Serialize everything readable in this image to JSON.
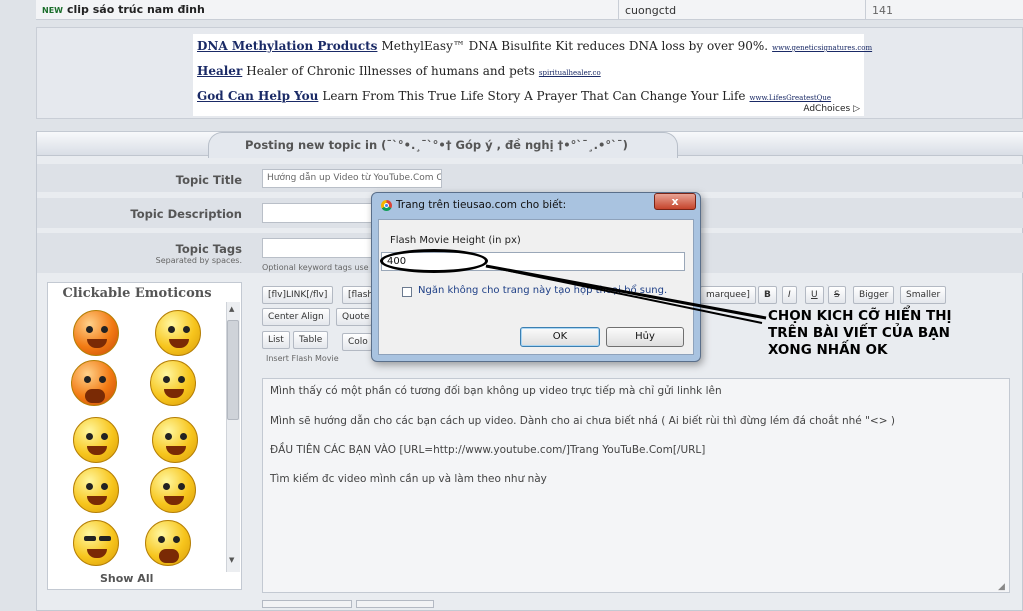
{
  "topic_row": {
    "badge": "NEW",
    "title": "clip sáo trúc nam đinh",
    "author": "cuongctd",
    "count": "141"
  },
  "ads": {
    "items": [
      {
        "headline": "DNA Methylation Products",
        "text": "MethylEasy™ DNA Bisulfite Kit reduces DNA loss by over 90%.",
        "url": "www.geneticsignatures.com"
      },
      {
        "headline": "Healer",
        "text": "Healer of Chronic Illnesses of humans and pets",
        "url": "spiritualhealer.co"
      },
      {
        "headline": "God Can Help You",
        "text": "Learn From This True Life Story A Prayer That Can Change Your Life",
        "url": "www.LifesGreatestQue"
      }
    ],
    "adchoices": "AdChoices ▷"
  },
  "form": {
    "header": "Posting new topic in (¯`°•.¸¯`°•† Góp ý , đề nghị †•°`¯¸.•°`¯)",
    "title_label": "Topic Title",
    "title_value": "Hướng dẫn up Video từ YouTube.Com Cho MEI",
    "description_label": "Topic Description",
    "tags_label": "Topic Tags",
    "tags_sub": "Separated by spaces.",
    "tags_hint": "Optional keyword tags use",
    "emoticons_title": "Clickable Emoticons",
    "show_all": "Show All"
  },
  "toolbar": {
    "row1": [
      "[flv]LINK[/flv]",
      "[flash",
      "marquee]",
      "B",
      "I",
      "U",
      "S",
      "Bigger",
      "Smaller"
    ],
    "row2": [
      "Center Align",
      "Quote"
    ],
    "row3": [
      "List",
      "Table",
      "Colo"
    ],
    "hint": "Insert Flash Movie"
  },
  "editor": {
    "lines": [
      "Mình thấy có một phần có tương đối bạn không up video trực tiếp mà chỉ gửi linhk lên",
      "Mình sẽ hướng dẫn cho các bạn cách up video. Dành cho ai chưa biết nhá ( Ai biết rùi thì đừng lém đá choắt nhé \"<> )",
      "ĐẦU TIÊN CÁC BẠN VÀO [URL=http://www.youtube.com/]Trang YouTuBe.Com[/URL]",
      "Tìm kiếm đc video mình cần up và làm theo như này"
    ]
  },
  "dialog": {
    "title": "Trang trên tieusao.com cho biết:",
    "close": "x",
    "label": "Flash Movie Height (in px)",
    "value": "400",
    "checkbox_label": "Ngăn không cho trang này tạo hộp thoại bổ sung.",
    "ok": "OK",
    "cancel": "Hủy"
  },
  "annotation": {
    "text": "CHỌN KICH CỠ HIỂN THỊ TRÊN BÀI VIẾT CỦA BẠN XONG NHẤN OK"
  }
}
